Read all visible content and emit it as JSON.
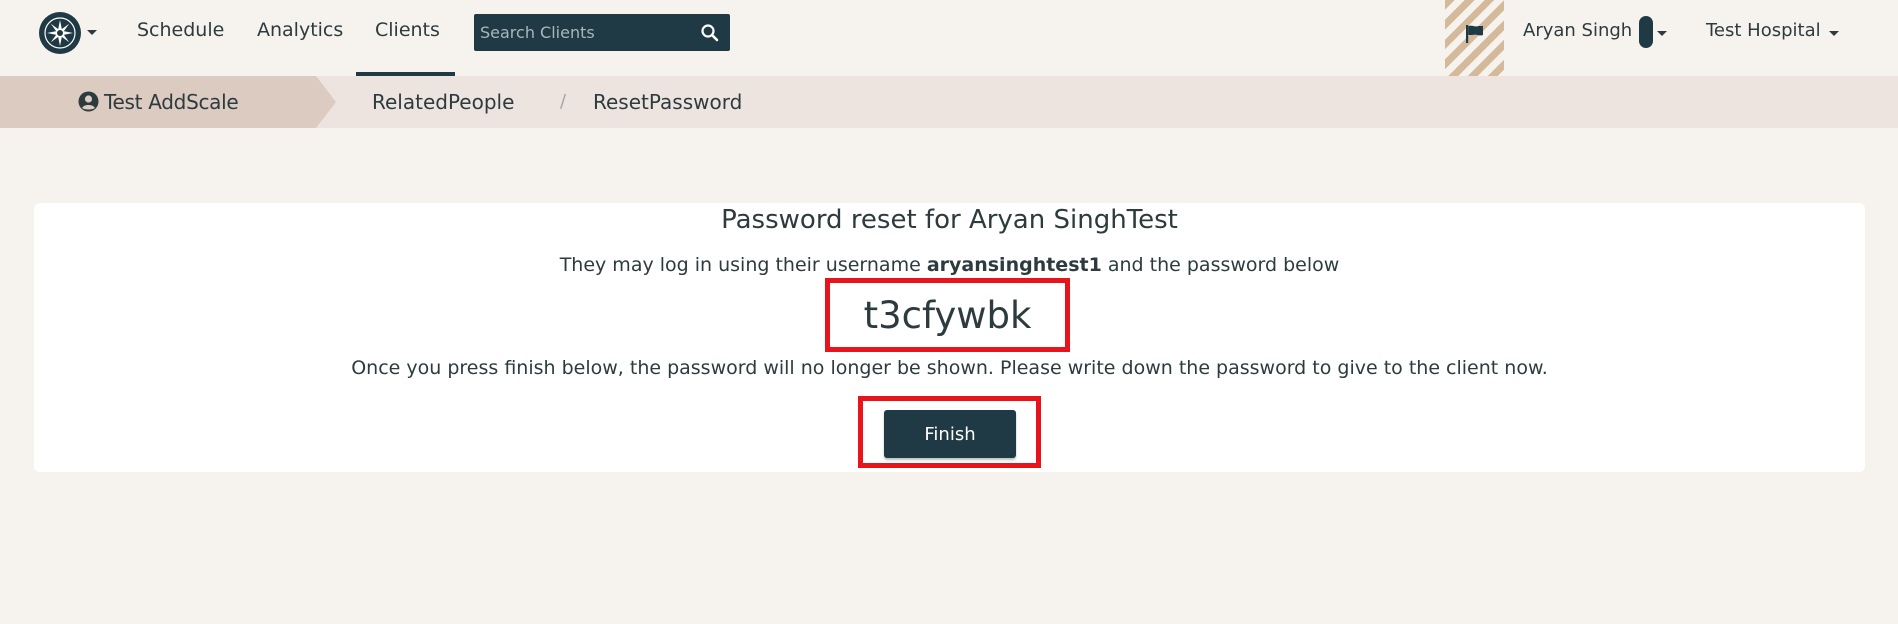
{
  "navbar": {
    "logo_icon": "starburst-logo-icon",
    "links": {
      "schedule": "Schedule",
      "analytics": "Analytics",
      "clients": "Clients"
    },
    "active_link": "Clients",
    "search": {
      "placeholder": "Search Clients",
      "value": "",
      "icon": "search-icon"
    },
    "flag_icon": "flag-icon",
    "user_name": "Aryan Singh",
    "organization": "Test Hospital"
  },
  "breadcrumb": {
    "client_icon": "user-circle-icon",
    "client_name": "Test AddScale",
    "related": "RelatedPeople",
    "separator": "/",
    "current": "ResetPassword"
  },
  "card": {
    "title": "Password reset for Aryan SinghTest",
    "info_prefix": "They may log in using their username",
    "username": "aryansinghtest1",
    "info_suffix": "and the password below",
    "password": "t3cfywbk",
    "warning": "Once you press finish below, the password will no longer be shown. Please write down the password to give to the client now.",
    "finish_label": "Finish"
  },
  "colors": {
    "page_background": "#f6f3ef",
    "primary_dark": "#1f3a44",
    "breadcrumb_bar": "#ede4df",
    "breadcrumb_active": "#dccbc0",
    "highlight_red": "#e8141b",
    "flag_stripe": "#d5b99b"
  }
}
